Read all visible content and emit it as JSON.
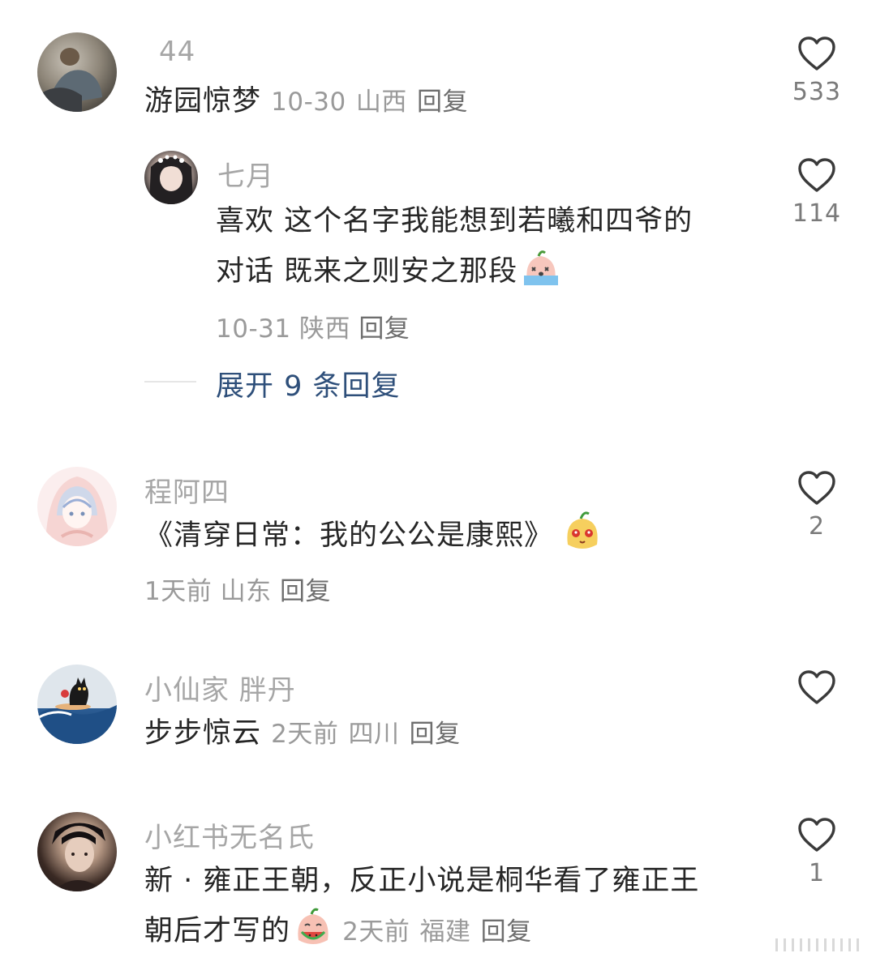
{
  "comments": [
    {
      "name": "44",
      "text_before": "游园惊梦",
      "date": "10-30",
      "location": "山西",
      "reply": "回复",
      "likes": "533",
      "avatar": "photo-avatar-man-sitting"
    },
    {
      "name": "七月",
      "line1": "喜欢 这个名字我能想到若曦和四爷的",
      "line2": "对话 既来之则安之那段",
      "emoji": "crying-peach-emoji",
      "date": "10-31",
      "location": "陕西",
      "reply": "回复",
      "likes": "114",
      "avatar": "photo-avatar-girl"
    },
    {
      "name": "程阿四",
      "text": "《清穿日常：我的公公是康熙》",
      "emoji": "peach-face-emoji",
      "date": "1天前",
      "location": "山东",
      "reply": "回复",
      "likes": "2",
      "avatar": "cartoon-avatar-hooded-girl"
    },
    {
      "name": "小仙家 胖丹",
      "text_before": "步步惊云",
      "date": "2天前",
      "location": "四川",
      "reply": "回复",
      "likes": "",
      "avatar": "cat-on-wave-avatar"
    },
    {
      "name": "小红书无名氏",
      "line1": "新 · 雍正王朝，反正小说是桐华看了雍正王",
      "line2": "朝后才写的",
      "emoji": "peach-eating-watermelon-emoji",
      "date": "2天前",
      "location": "福建",
      "reply": "回复",
      "likes": "1",
      "avatar": "photo-avatar-man-costume"
    }
  ],
  "expand_replies": "展开 9 条回复",
  "icons": {
    "like": "heart-outline-icon"
  },
  "colors": {
    "name": "#a6a6a6",
    "text": "#262626",
    "link": "#2e4f7a",
    "meta": "#9a9a9a"
  }
}
